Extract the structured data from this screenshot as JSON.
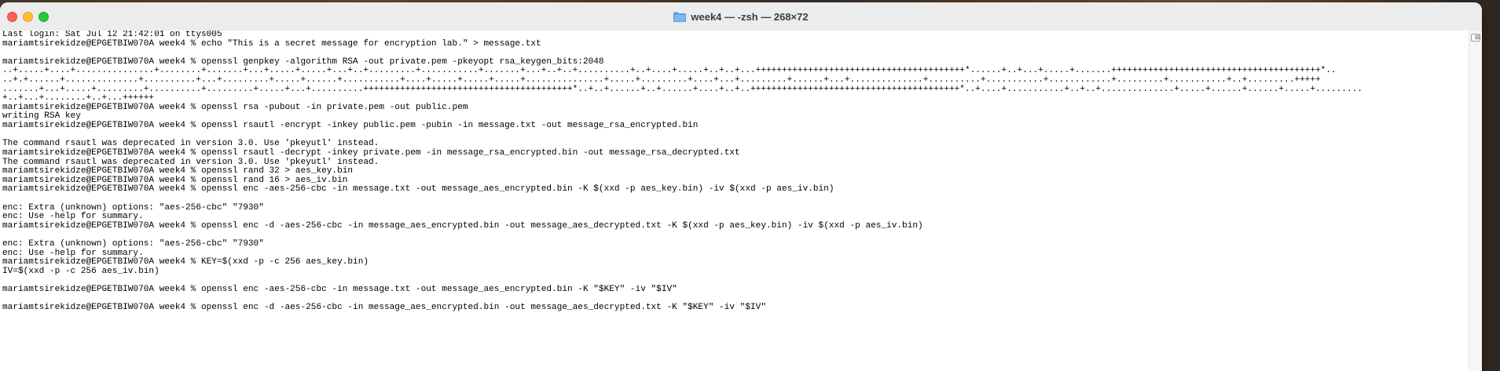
{
  "window": {
    "title": "week4 — -zsh — 268×72"
  },
  "terminal": {
    "lines": [
      "Last login: Sat Jul 12 21:42:01 on ttys005",
      "mariamtsirekidze@EPGETBIW070A week4 % echo \"This is a secret message for encryption lab.\" > message.txt",
      "",
      "mariamtsirekidze@EPGETBIW070A week4 % openssl genpkey -algorithm RSA -out private.pem -pkeyopt rsa_keygen_bits:2048",
      "..+.....+....+...............+........+.......+...+.....+.....+...+..+.........+...........+.......+...+..+..+..........+..+....+.....+..+..+...++++++++++++++++++++++++++++++++++++++++*......+..+...+.....+.......++++++++++++++++++++++++++++++++++++++++*..",
      "..+.+......+..............+..........+...+.........+.....+......+...........+....+.....+.....+.....+...............+.....+.........+....+...+.........+......+...+..............+..........+...........+............+.........+...........+..+.........+++++",
      ".......+...+.....+.........+..........+.........+.....+...+..........++++++++++++++++++++++++++++++++++++++++*..+..+......+..+......+....+..+..++++++++++++++++++++++++++++++++++++++++*..+....+...........+..+..+..............+.....+......+......+.....+.........",
      "+..+...+........+..+...++++++",
      "mariamtsirekidze@EPGETBIW070A week4 % openssl rsa -pubout -in private.pem -out public.pem",
      "writing RSA key",
      "mariamtsirekidze@EPGETBIW070A week4 % openssl rsautl -encrypt -inkey public.pem -pubin -in message.txt -out message_rsa_encrypted.bin",
      "",
      "The command rsautl was deprecated in version 3.0. Use 'pkeyutl' instead.",
      "mariamtsirekidze@EPGETBIW070A week4 % openssl rsautl -decrypt -inkey private.pem -in message_rsa_encrypted.bin -out message_rsa_decrypted.txt",
      "The command rsautl was deprecated in version 3.0. Use 'pkeyutl' instead.",
      "mariamtsirekidze@EPGETBIW070A week4 % openssl rand 32 > aes_key.bin",
      "mariamtsirekidze@EPGETBIW070A week4 % openssl rand 16 > aes_iv.bin",
      "mariamtsirekidze@EPGETBIW070A week4 % openssl enc -aes-256-cbc -in message.txt -out message_aes_encrypted.bin -K $(xxd -p aes_key.bin) -iv $(xxd -p aes_iv.bin)",
      "",
      "enc: Extra (unknown) options: \"aes-256-cbc\" \"7930\"",
      "enc: Use -help for summary.",
      "mariamtsirekidze@EPGETBIW070A week4 % openssl enc -d -aes-256-cbc -in message_aes_encrypted.bin -out message_aes_decrypted.txt -K $(xxd -p aes_key.bin) -iv $(xxd -p aes_iv.bin)",
      "",
      "enc: Extra (unknown) options: \"aes-256-cbc\" \"7930\"",
      "enc: Use -help for summary.",
      "mariamtsirekidze@EPGETBIW070A week4 % KEY=$(xxd -p -c 256 aes_key.bin)",
      "IV=$(xxd -p -c 256 aes_iv.bin)",
      "",
      "mariamtsirekidze@EPGETBIW070A week4 % openssl enc -aes-256-cbc -in message.txt -out message_aes_encrypted.bin -K \"$KEY\" -iv \"$IV\"",
      "",
      "mariamtsirekidze@EPGETBIW070A week4 % openssl enc -d -aes-256-cbc -in message_aes_encrypted.bin -out message_aes_decrypted.txt -K \"$KEY\" -iv \"$IV\""
    ]
  },
  "icons": {
    "title_icon": "folder-icon",
    "close": "close-button",
    "minimize": "minimize-button",
    "maximize": "zoom-button"
  },
  "colors": {
    "close": "#ff5f57",
    "minimize": "#febc2e",
    "maximize": "#28c840",
    "folder": "#5aa5e6"
  }
}
